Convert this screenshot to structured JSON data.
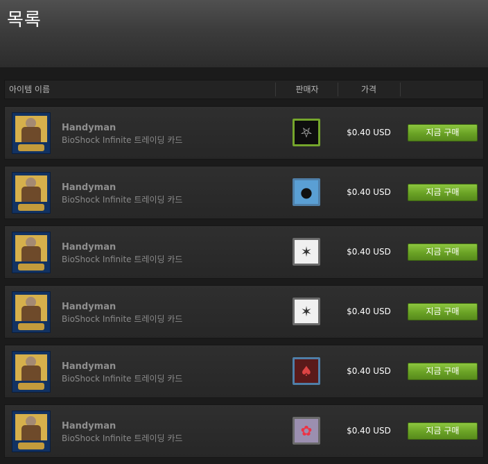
{
  "page": {
    "title": "목록"
  },
  "columns": {
    "name": "아이템 이름",
    "seller": "판매자",
    "price": "가격"
  },
  "listings": [
    {
      "item_name": "Handyman",
      "game": "BioShock Infinite 트레이딩 카드",
      "price": "$0.40 USD",
      "buy_label": "지금 구매",
      "seller_icon": "pentagram-avatar"
    },
    {
      "item_name": "Handyman",
      "game": "BioShock Infinite 트레이딩 카드",
      "price": "$0.40 USD",
      "buy_label": "지금 구매",
      "seller_icon": "penguin-avatar"
    },
    {
      "item_name": "Handyman",
      "game": "BioShock Infinite 트레이딩 카드",
      "price": "$0.40 USD",
      "buy_label": "지금 구매",
      "seller_icon": "cartoon-sketch-avatar"
    },
    {
      "item_name": "Handyman",
      "game": "BioShock Infinite 트레이딩 카드",
      "price": "$0.40 USD",
      "buy_label": "지금 구매",
      "seller_icon": "cartoon-sketch-avatar"
    },
    {
      "item_name": "Handyman",
      "game": "BioShock Infinite 트레이딩 카드",
      "price": "$0.40 USD",
      "buy_label": "지금 구매",
      "seller_icon": "red-figure-avatar"
    },
    {
      "item_name": "Handyman",
      "game": "BioShock Infinite 트레이딩 카드",
      "price": "$0.40 USD",
      "buy_label": "지금 구매",
      "seller_icon": "anime-avatar"
    }
  ],
  "colors": {
    "buy_button": "#6aa225",
    "background": "#1b1b1b",
    "price_text": "#ffffff"
  }
}
